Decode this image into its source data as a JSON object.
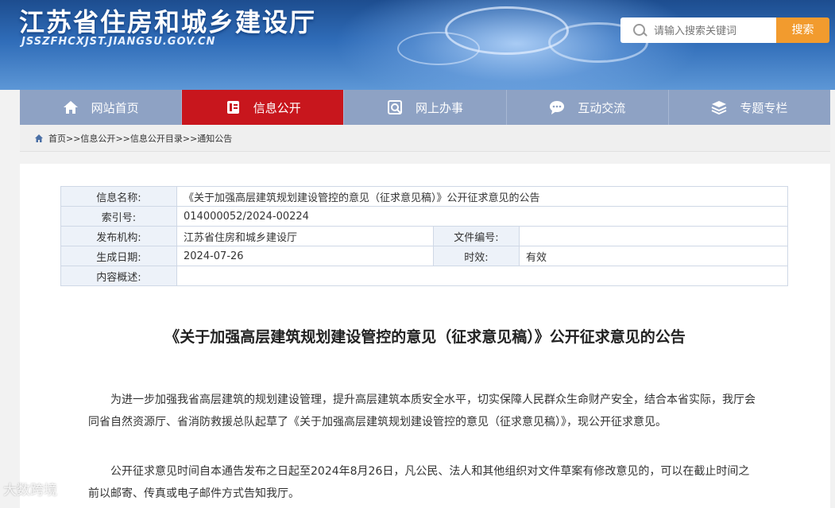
{
  "header": {
    "site_title": "江苏省住房和城乡建设厅",
    "domain": "JSSZFHCXJST.JIANGSU.GOV.CN"
  },
  "search": {
    "placeholder": "请输入搜索关键词",
    "button_label": "搜索"
  },
  "nav": {
    "items": [
      {
        "label": "网站首页",
        "icon": "home-icon"
      },
      {
        "label": "信息公开",
        "icon": "document-icon",
        "active": true
      },
      {
        "label": "网上办事",
        "icon": "service-icon"
      },
      {
        "label": "互动交流",
        "icon": "chat-icon"
      },
      {
        "label": "专题专栏",
        "icon": "layers-icon"
      }
    ]
  },
  "breadcrumb": {
    "items": [
      "首页",
      ">>信息公开",
      ">>信息公开目录",
      ">>通知公告"
    ]
  },
  "meta": {
    "name_label": "信息名称:",
    "name_value": "《关于加强高层建筑规划建设管控的意见（征求意见稿）》公开征求意见的公告",
    "index_label": "索引号:",
    "index_value": "014000052/2024-00224",
    "publisher_label": "发布机构:",
    "publisher_value": "江苏省住房和城乡建设厅",
    "docno_label": "文件编号:",
    "docno_value": "",
    "date_label": "生成日期:",
    "date_value": "2024-07-26",
    "validity_label": "时效:",
    "validity_value": "有效",
    "summary_label": "内容概述:",
    "summary_value": ""
  },
  "article": {
    "title": "《关于加强高层建筑规划建设管控的意见（征求意见稿）》公开征求意见的公告",
    "paragraphs": [
      "为进一步加强我省高层建筑的规划建设管理，提升高层建筑本质安全水平，切实保障人民群众生命财产安全，结合本省实际，我厅会同省自然资源厅、省消防救援总队起草了《关于加强高层建筑规划建设管控的意见（征求意见稿）》，现公开征求意见。",
      "公开征求意见时间自本通告发布之日起至2024年8月26日，凡公民、法人和其他组织对文件草案有修改意见的，可以在截止时间之前以邮寄、传真或电子邮件方式告知我厅。"
    ]
  },
  "watermark": "大数跨境"
}
